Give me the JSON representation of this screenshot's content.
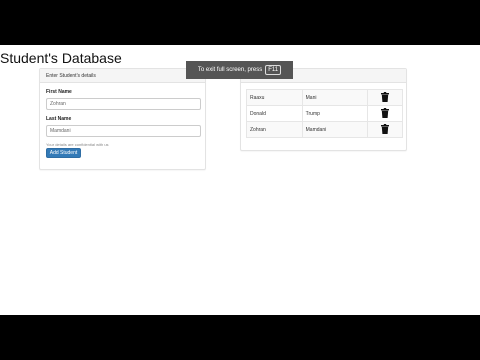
{
  "page": {
    "title": "Student's Database"
  },
  "fullscreen_banner": {
    "message": "To exit full screen, press",
    "key": "F11"
  },
  "form": {
    "header": "Enter Student's details",
    "first_name_label": "First Name",
    "first_name_value": "Zohran",
    "last_name_label": "Last Name",
    "last_name_value": "Mamdani",
    "help_text": "Your details are confidential with us",
    "submit_label": "Add Student"
  },
  "students": [
    {
      "first": "Raaxu",
      "last": "Mani",
      "action_icon": "trash-icon"
    },
    {
      "first": "Donald",
      "last": "Trump",
      "action_icon": "trash-icon"
    },
    {
      "first": "Zohran",
      "last": "Mamdani",
      "action_icon": "trash-icon"
    }
  ],
  "colors": {
    "primary_button": "#337ab7",
    "panel_header": "#f5f5f5",
    "letterbox": "#000000"
  }
}
